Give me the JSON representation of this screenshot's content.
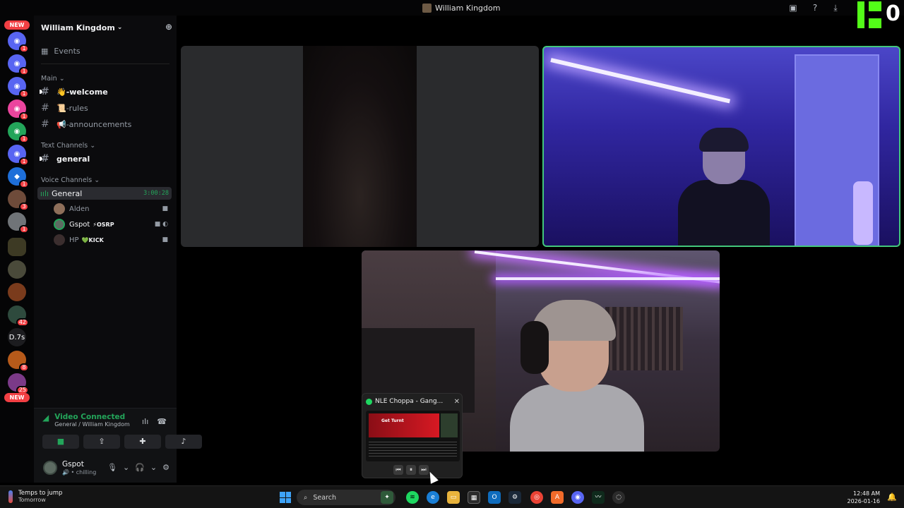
{
  "window": {
    "title": "William Kingdom"
  },
  "kick_overlay": {
    "count": "0",
    "brand_color": "#53fc18"
  },
  "rail": {
    "new_label_top": "NEW",
    "new_label_bottom": "NEW",
    "text_server": "D.7s",
    "badges": [
      "1",
      "1",
      "1",
      "1",
      "1",
      "1",
      "1",
      "3",
      "1",
      "42",
      "8",
      "25"
    ]
  },
  "server": {
    "name": "William Kingdom",
    "events_label": "Events",
    "categories": {
      "main": "Main",
      "text": "Text Channels",
      "voice": "Voice Channels"
    },
    "channels": {
      "welcome": "👋-welcome",
      "rules": "📜-rules",
      "announcements": "📢-announcements",
      "general_text": "general"
    },
    "voice_channel": {
      "name": "General",
      "timer": "3:00:28"
    },
    "voice_users": [
      {
        "name": "Alden",
        "tag": ""
      },
      {
        "name": "Gspot",
        "tag": "⚡OSRP"
      },
      {
        "name": "HP",
        "tag": "💚KICK"
      }
    ]
  },
  "voice_panel": {
    "status": "Video Connected",
    "location": "General / William Kingdom"
  },
  "user_panel": {
    "username": "Gspot",
    "status": "chilling"
  },
  "spotify": {
    "track": "NLE Choppa - Gang...",
    "thumb_text": "Get Turnt",
    "accent": "#1ed760"
  },
  "taskbar": {
    "weather_title": "Temps to jump",
    "weather_sub": "Tomorrow",
    "search_placeholder": "Search",
    "time": "12:48 AM",
    "date": "2026-01-16"
  },
  "colors": {
    "speaking_border": "#43c77b",
    "voice_green": "#23a55a",
    "badge_red": "#f23f43"
  }
}
